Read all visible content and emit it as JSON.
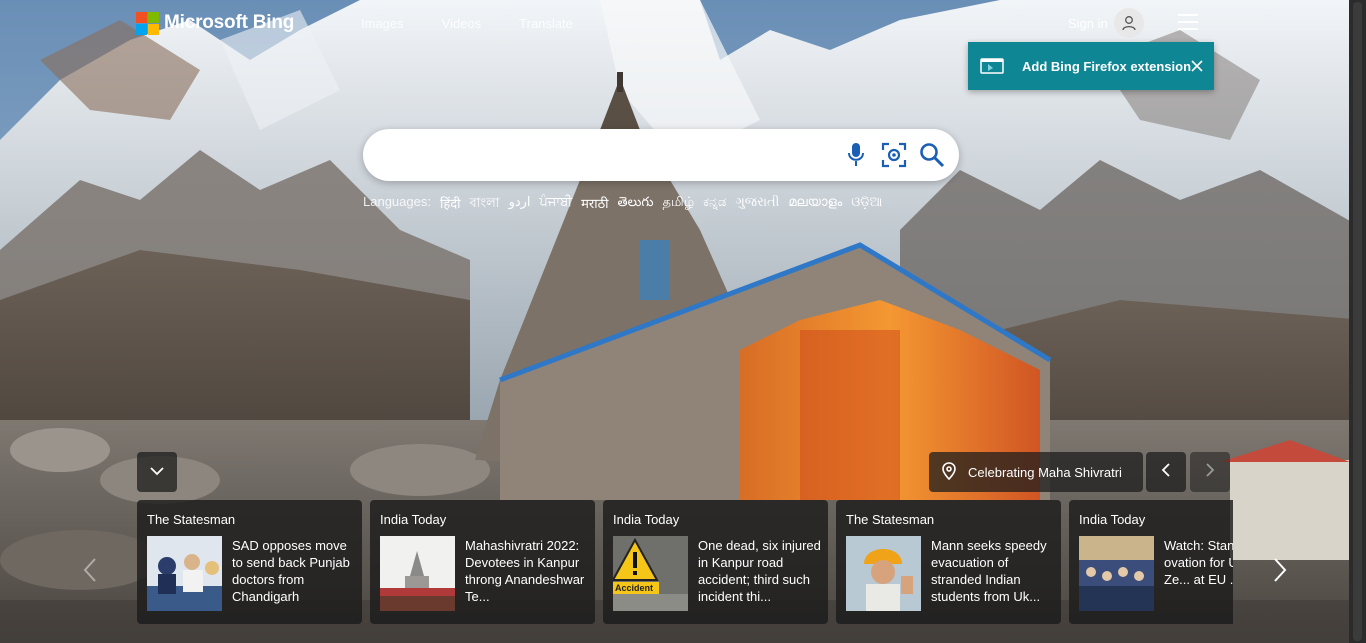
{
  "header": {
    "brand": "Microsoft Bing",
    "nav": [
      "Images",
      "Videos",
      "Translate"
    ],
    "sign_in": "Sign in"
  },
  "extension_banner": {
    "text": "Add Bing Firefox extension"
  },
  "search": {
    "value": "",
    "placeholder": ""
  },
  "languages": {
    "label": "Languages:",
    "items": [
      "हिंदी",
      "বাংলা",
      "اردو",
      "ਪੰਜਾਬੀ",
      "मराठी",
      "తెలుగు",
      "தமிழ்",
      "ಕನ್ನಡ",
      "ગુજરાતી",
      "മലയാളം",
      "ଓଡ଼ିଆ"
    ]
  },
  "image_caption": {
    "text": "Celebrating Maha Shivratri"
  },
  "news": [
    {
      "source": "The Statesman",
      "headline": "SAD opposes move to send back Punjab doctors from Chandigarh"
    },
    {
      "source": "India Today",
      "headline": "Mahashivratri 2022: Devotees in Kanpur throng Anandeshwar Te..."
    },
    {
      "source": "India Today",
      "headline": "One dead, six injured in Kanpur road accident; third such incident thi..."
    },
    {
      "source": "The Statesman",
      "headline": "Mann seeks speedy evacuation of stranded Indian students from Uk..."
    },
    {
      "source": "India Today",
      "headline": "Watch: Standing ovation for Ukraine's Ze... at EU ..."
    }
  ],
  "thumb_texts": {
    "accident": "Accident"
  },
  "colors": {
    "logo_red": "#f25022",
    "logo_green": "#7fba00",
    "logo_blue": "#00a4ef",
    "logo_yellow": "#ffb900",
    "banner_teal": "#0f8694",
    "search_icon_blue": "#1a5fb4"
  },
  "icons": [
    "microphone-icon",
    "visual-search-icon",
    "search-icon",
    "location-pin-icon",
    "chevron-left-icon",
    "chevron-right-icon",
    "chevron-down-icon",
    "close-icon",
    "user-icon",
    "hamburger-icon"
  ]
}
